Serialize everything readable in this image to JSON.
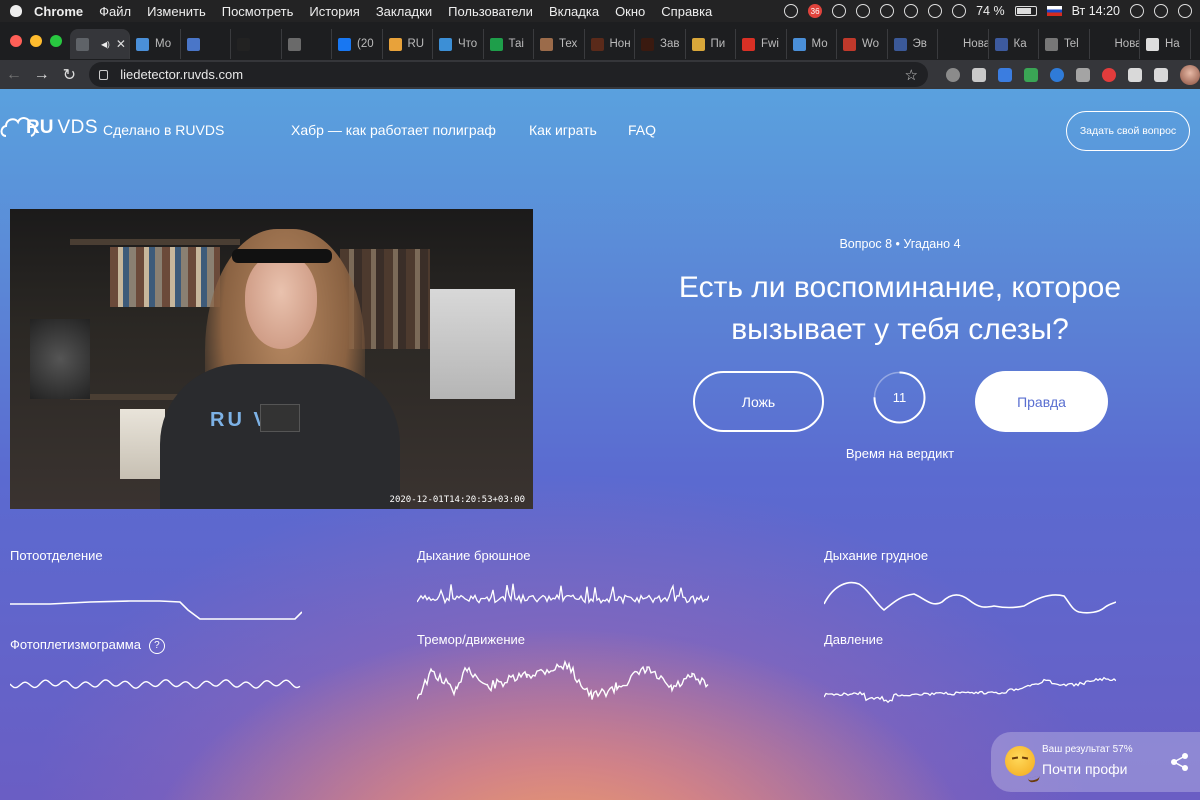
{
  "menubar": {
    "app": "Chrome",
    "items": [
      "Файл",
      "Изменить",
      "Посмотреть",
      "История",
      "Закладки",
      "Пользователи",
      "Вкладка",
      "Окно",
      "Справка"
    ],
    "badge_count": "36",
    "battery": "74 %",
    "clock": "Вт 14:20"
  },
  "tabs": [
    {
      "label": "",
      "icon": "page-icon",
      "color": "#5f6368"
    },
    {
      "label": "Мо",
      "icon": "cloud-icon",
      "color": "#4a8fd8"
    },
    {
      "label": "",
      "icon": "d-icon",
      "color": "#4a76c8"
    },
    {
      "label": "",
      "icon": "t-icon",
      "color": "#222222"
    },
    {
      "label": "",
      "icon": "yc-icon",
      "color": "#6a6a6a"
    },
    {
      "label": "(20",
      "icon": "facebook-icon",
      "color": "#1877f2"
    },
    {
      "label": "RU",
      "icon": "k-icon",
      "color": "#e8a23a"
    },
    {
      "label": "Что",
      "icon": "asterisk-icon",
      "color": "#3c8fd6"
    },
    {
      "label": "Таі",
      "icon": "plus-icon",
      "color": "#1e9e4a"
    },
    {
      "label": "Тех",
      "icon": "person-icon",
      "color": "#9b6b4a"
    },
    {
      "label": "Нон",
      "icon": "m-icon",
      "color": "#5a2a1a"
    },
    {
      "label": "Зав",
      "icon": "m-icon",
      "color": "#3a1a10"
    },
    {
      "label": "Пи",
      "icon": "mail-icon",
      "color": "#d9a73a"
    },
    {
      "label": "Fwi",
      "icon": "gmail-icon",
      "color": "#d93025"
    },
    {
      "label": "Мо",
      "icon": "cloud-icon",
      "color": "#4a8fd8"
    },
    {
      "label": "Wo",
      "icon": "w-icon",
      "color": "#c0392b"
    },
    {
      "label": "Эв",
      "icon": "person-icon",
      "color": "#3b5998"
    },
    {
      "label": "Новая",
      "icon": "none",
      "color": "#1d1e20"
    },
    {
      "label": "Ка",
      "icon": "p-icon",
      "color": "#3d5a9e"
    },
    {
      "label": "Tel",
      "icon": "globe-icon",
      "color": "#777777"
    },
    {
      "label": "Новая",
      "icon": "none",
      "color": "#1d1e20"
    },
    {
      "label": "На",
      "icon": "gear-icon",
      "color": "#dddddd"
    }
  ],
  "toolbar": {
    "url": "liedetector.ruvds.com"
  },
  "header": {
    "logo_ru": "RU",
    "logo_vds": "VDS",
    "made_in": "Сделано в RUVDS",
    "habr_link": "Хабр — как работает полиграф",
    "how_to_play": "Как играть",
    "faq": "FAQ",
    "ask_button": "Задать свой вопрос"
  },
  "video": {
    "shirt_text": "RU VD",
    "timestamp": "2020-12-01T14:20:53+03:00"
  },
  "question": {
    "meta": "Вопрос 8 • Угадано 4",
    "text": "Есть ли воспоминание, которое вызывает у тебя слезы?",
    "lie_button": "Ложь",
    "truth_button": "Правда",
    "timer": "11",
    "timer_fraction": 0.75,
    "verdict_label": "Время на вердикт"
  },
  "sensors": {
    "sweat": "Потоотделение",
    "belly_breath": "Дыхание брюшное",
    "chest_breath": "Дыхание грудное",
    "ppg": "Фотоплетизмограмма",
    "ppg_help": "?",
    "tremor": "Тремор/движение",
    "pressure": "Давление"
  },
  "result": {
    "score": "Ваш результат 57%",
    "rank": "Почти профи"
  },
  "colors": {
    "accent": "#5a6fd1",
    "page_top": "#5aa1de",
    "page_bottom": "#6a5ec4",
    "glow": "#f0a262"
  }
}
